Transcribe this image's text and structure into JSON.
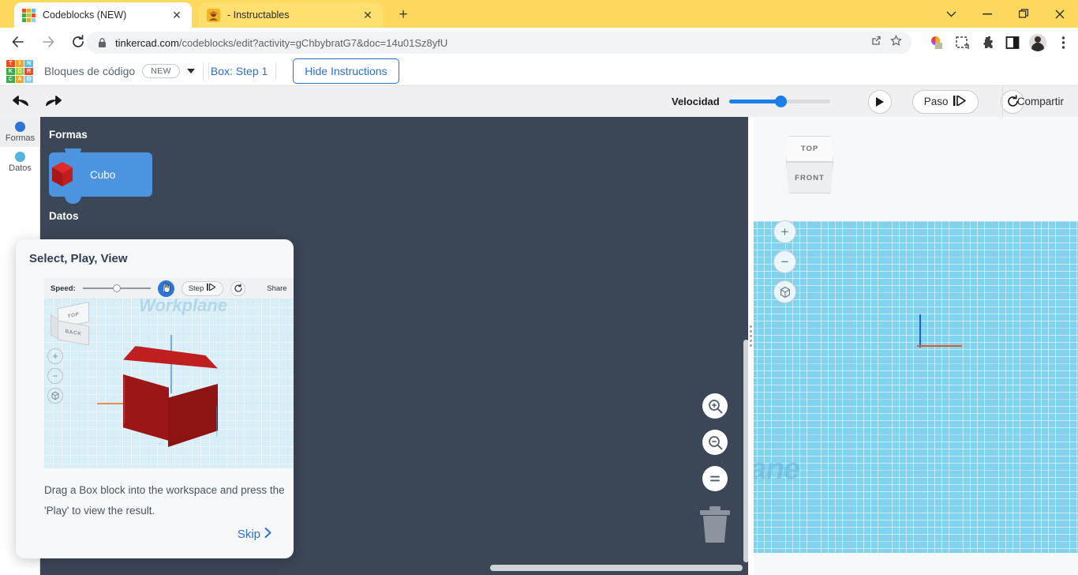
{
  "browser": {
    "tabs": [
      {
        "title": "Codeblocks (NEW)",
        "favicon": "tinkercad-icon",
        "active": true
      },
      {
        "title": "- Instructables",
        "favicon": "instructables-icon",
        "active": false
      }
    ],
    "new_tab_label": "+",
    "window_controls": {
      "tab_search": "tab-search-icon",
      "minimize": "minimize-icon",
      "maximize": "maximize-icon",
      "close": "close-icon"
    },
    "nav": {
      "back": "back-arrow-icon",
      "forward": "forward-arrow-icon",
      "reload": "reload-icon"
    },
    "omnibox": {
      "lock": "lock-icon",
      "url_domain": "tinkercad.com",
      "url_path": "/codeblocks/edit?activity=gChbybratG7&doc=14u01Sz8yfU",
      "share_icon": "share-icon",
      "bookmark_icon": "star-icon"
    },
    "extensions": [
      "color-picker-icon",
      "screenshot-icon",
      "puzzle-icon",
      "sidebar-icon"
    ],
    "profile": "avatar",
    "menu": "kebab-menu-icon"
  },
  "header": {
    "logo_tiles": [
      {
        "letter": "T",
        "color": "#f04d23"
      },
      {
        "letter": "I",
        "color": "#f6a623"
      },
      {
        "letter": "N",
        "color": "#58c3ea"
      },
      {
        "letter": "K",
        "color": "#3faa4b"
      },
      {
        "letter": "C",
        "color": "#a6d13c"
      },
      {
        "letter": "R",
        "color": "#f04d23"
      },
      {
        "letter": "C",
        "color": "#3faa4b"
      },
      {
        "letter": "A",
        "color": "#f6a623"
      },
      {
        "letter": "D",
        "color": "#8fd0ef"
      }
    ],
    "title": "Bloques de código",
    "badge": "NEW",
    "dropdown": "chevron-down-icon",
    "step_label": "Box: Step 1",
    "hide_instructions": "Hide Instructions"
  },
  "toolbar": {
    "undo": "undo-icon",
    "redo": "redo-icon",
    "speed_label": "Velocidad",
    "speed_value": 52,
    "play": "play-icon",
    "step_label": "Paso",
    "step_icon": "step-forward-icon",
    "reset": "reset-icon",
    "share_label": "Compartir"
  },
  "sidebar": {
    "items": [
      {
        "label": "Formas",
        "color": "#2d74d6",
        "active": true
      },
      {
        "label": "Datos",
        "color": "#57b2e0",
        "active": false
      }
    ]
  },
  "palette": {
    "section_shapes": "Formas",
    "section_data": "Datos",
    "blocks": [
      {
        "label": "Cubo",
        "icon": "red-cube-icon",
        "color": "#4d94e0"
      }
    ]
  },
  "workspace": {
    "zoom_in": "zoom-in-icon",
    "zoom_out": "zoom-out-icon",
    "zoom_fit": "zoom-fit-icon",
    "trash": "trash-icon",
    "scrollbars": {
      "vertical": "vertical-scrollbar",
      "horizontal": "horizontal-scrollbar"
    }
  },
  "viewport": {
    "viewcube": {
      "top": "TOP",
      "front": "FRONT"
    },
    "controls": {
      "zoom_in": "+",
      "zoom_out": "−",
      "fit": "fit-view-icon"
    },
    "workplane_text": "lane",
    "grid_color": "#7fd3ee"
  },
  "popup": {
    "title": "Select, Play, View",
    "mini_toolbar": {
      "speed_label": "Speed:",
      "speed_value": 45,
      "play": "play-icon",
      "cursor_overlay": "hand-cursor-icon",
      "step_label": "Step",
      "step_icon": "step-forward-icon",
      "reset": "reset-icon",
      "share_label": "Share"
    },
    "preview": {
      "viewcube_top": "TOP",
      "viewcube_front": "BACK",
      "workplane_text": "Workplane",
      "cube_color": "#c01f1f",
      "zoom_in": "+",
      "zoom_out": "−",
      "fit": "fit-view-icon"
    },
    "body_text": "Drag a Box block into the workspace and press the 'Play' to view the result.",
    "skip_label": "Skip",
    "skip_icon": "chevron-right-icon"
  }
}
